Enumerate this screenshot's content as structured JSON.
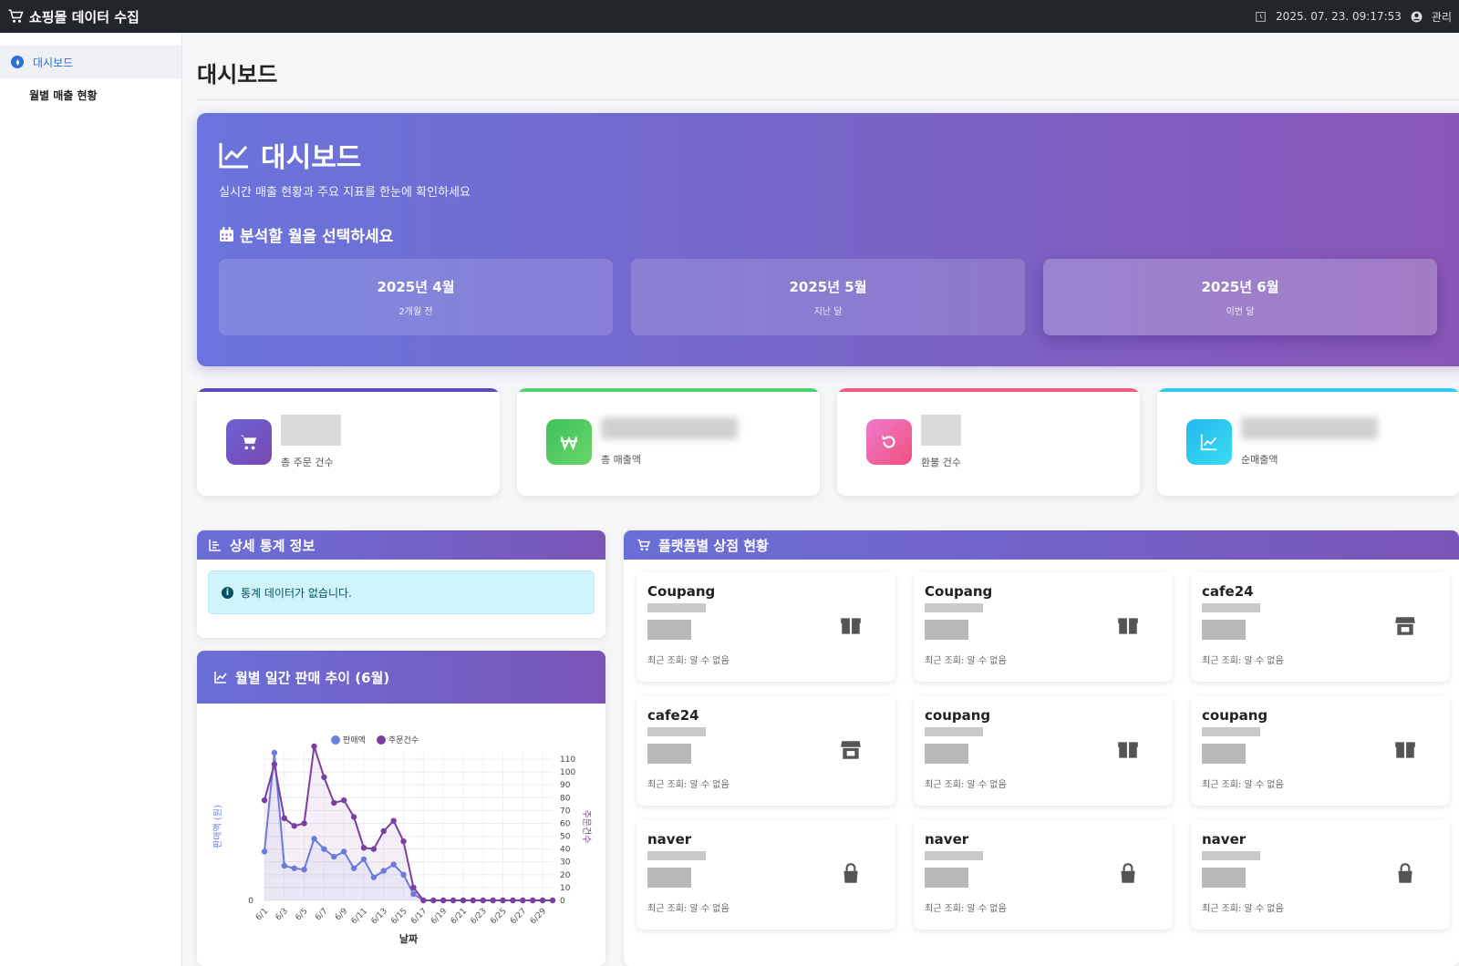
{
  "app": {
    "title": "쇼핑몰 데이터 수집",
    "datetime": "2025. 07. 23. 09:17:53",
    "user": "관리"
  },
  "sidebar": {
    "items": [
      {
        "label": "대시보드",
        "active": true
      },
      {
        "label": "월별 매출 현황",
        "active": false
      }
    ]
  },
  "page": {
    "title": "대시보드"
  },
  "hero": {
    "title": "대시보드",
    "subtitle": "실시간 매출 현황과 주요 지표를 한눈에 확인하세요",
    "month_prompt": "분석할 월을 선택하세요",
    "months": [
      {
        "name": "2025년 4월",
        "rel": "2개월 전"
      },
      {
        "name": "2025년 5월",
        "rel": "지난 달"
      },
      {
        "name": "2025년 6월",
        "rel": "이번 달",
        "selected": true
      }
    ]
  },
  "stats": [
    {
      "label": "총 주문 건수",
      "icon": "cart-icon",
      "color": "#7a55c8",
      "bar": "#5b4bb8"
    },
    {
      "label": "총 매출액",
      "icon": "won-icon",
      "color": "#3cc25a",
      "bar": "#4fd06c"
    },
    {
      "label": "환불 건수",
      "icon": "refresh-icon",
      "color": "#f25aa0",
      "bar": "#f05b86"
    },
    {
      "label": "순매출액",
      "icon": "chart-icon",
      "color": "#26c2ee",
      "bar": "#34c9f0"
    }
  ],
  "detail": {
    "title": "상세 통계 정보",
    "empty": "통계 데이터가 없습니다."
  },
  "trend": {
    "title": "월별 일간 판매 추이 (6월)",
    "chart_data": {
      "type": "line",
      "title": "",
      "xlabel": "날짜",
      "ylabel_left": "판매액 (원)",
      "ylabel_right": "주문건수",
      "x": [
        "6/1",
        "6/2",
        "6/3",
        "6/4",
        "6/5",
        "6/6",
        "6/7",
        "6/8",
        "6/9",
        "6/10",
        "6/11",
        "6/12",
        "6/13",
        "6/14",
        "6/15",
        "6/16",
        "6/17",
        "6/18",
        "6/19",
        "6/20",
        "6/21",
        "6/22",
        "6/23",
        "6/24",
        "6/25",
        "6/26",
        "6/27",
        "6/28",
        "6/29",
        "6/30"
      ],
      "x_ticks": [
        "6/1",
        "6/3",
        "6/5",
        "6/7",
        "6/9",
        "6/11",
        "6/13",
        "6/15",
        "6/17",
        "6/19",
        "6/21",
        "6/23",
        "6/25",
        "6/27",
        "6/29"
      ],
      "y_right_ticks": [
        0,
        10,
        20,
        30,
        40,
        50,
        60,
        70,
        80,
        90,
        100,
        110
      ],
      "y_left_ticks": [
        "0"
      ],
      "ylim_right": [
        0,
        115
      ],
      "series": [
        {
          "name": "판매액",
          "color": "#6a7fe0",
          "values": [
            38,
            115,
            27,
            25,
            24,
            48,
            40,
            34,
            38,
            25,
            32,
            18,
            23,
            28,
            20,
            5,
            0,
            0,
            0,
            0,
            0,
            0,
            0,
            0,
            0,
            0,
            0,
            0,
            0,
            0
          ]
        },
        {
          "name": "주문건수",
          "color": "#7a3fa0",
          "values": [
            78,
            106,
            64,
            58,
            60,
            120,
            96,
            76,
            78,
            65,
            41,
            40,
            54,
            62,
            46,
            10,
            0,
            0,
            0,
            0,
            0,
            0,
            0,
            0,
            0,
            0,
            0,
            0,
            0,
            0
          ]
        }
      ]
    }
  },
  "stores": {
    "title": "플랫폼별 상점 현황",
    "items": [
      {
        "name": "Coupang",
        "icon": "box-icon",
        "meta": "최근 조회: 알 수 없음"
      },
      {
        "name": "Coupang",
        "icon": "box-icon",
        "meta": "최근 조회: 알 수 없음"
      },
      {
        "name": "cafe24",
        "icon": "store-icon",
        "meta": "최근 조회: 알 수 없음"
      },
      {
        "name": "cafe24",
        "icon": "store-icon",
        "meta": "최근 조회: 알 수 없음"
      },
      {
        "name": "coupang",
        "icon": "box-icon",
        "meta": "최근 조회: 알 수 없음"
      },
      {
        "name": "coupang",
        "icon": "box-icon",
        "meta": "최근 조회: 알 수 없음"
      },
      {
        "name": "naver",
        "icon": "bag-icon",
        "meta": "최근 조회: 알 수 없음"
      },
      {
        "name": "naver",
        "icon": "bag-icon",
        "meta": "최근 조회: 알 수 없음"
      },
      {
        "name": "naver",
        "icon": "bag-icon",
        "meta": "최근 조회: 알 수 없음"
      }
    ]
  }
}
